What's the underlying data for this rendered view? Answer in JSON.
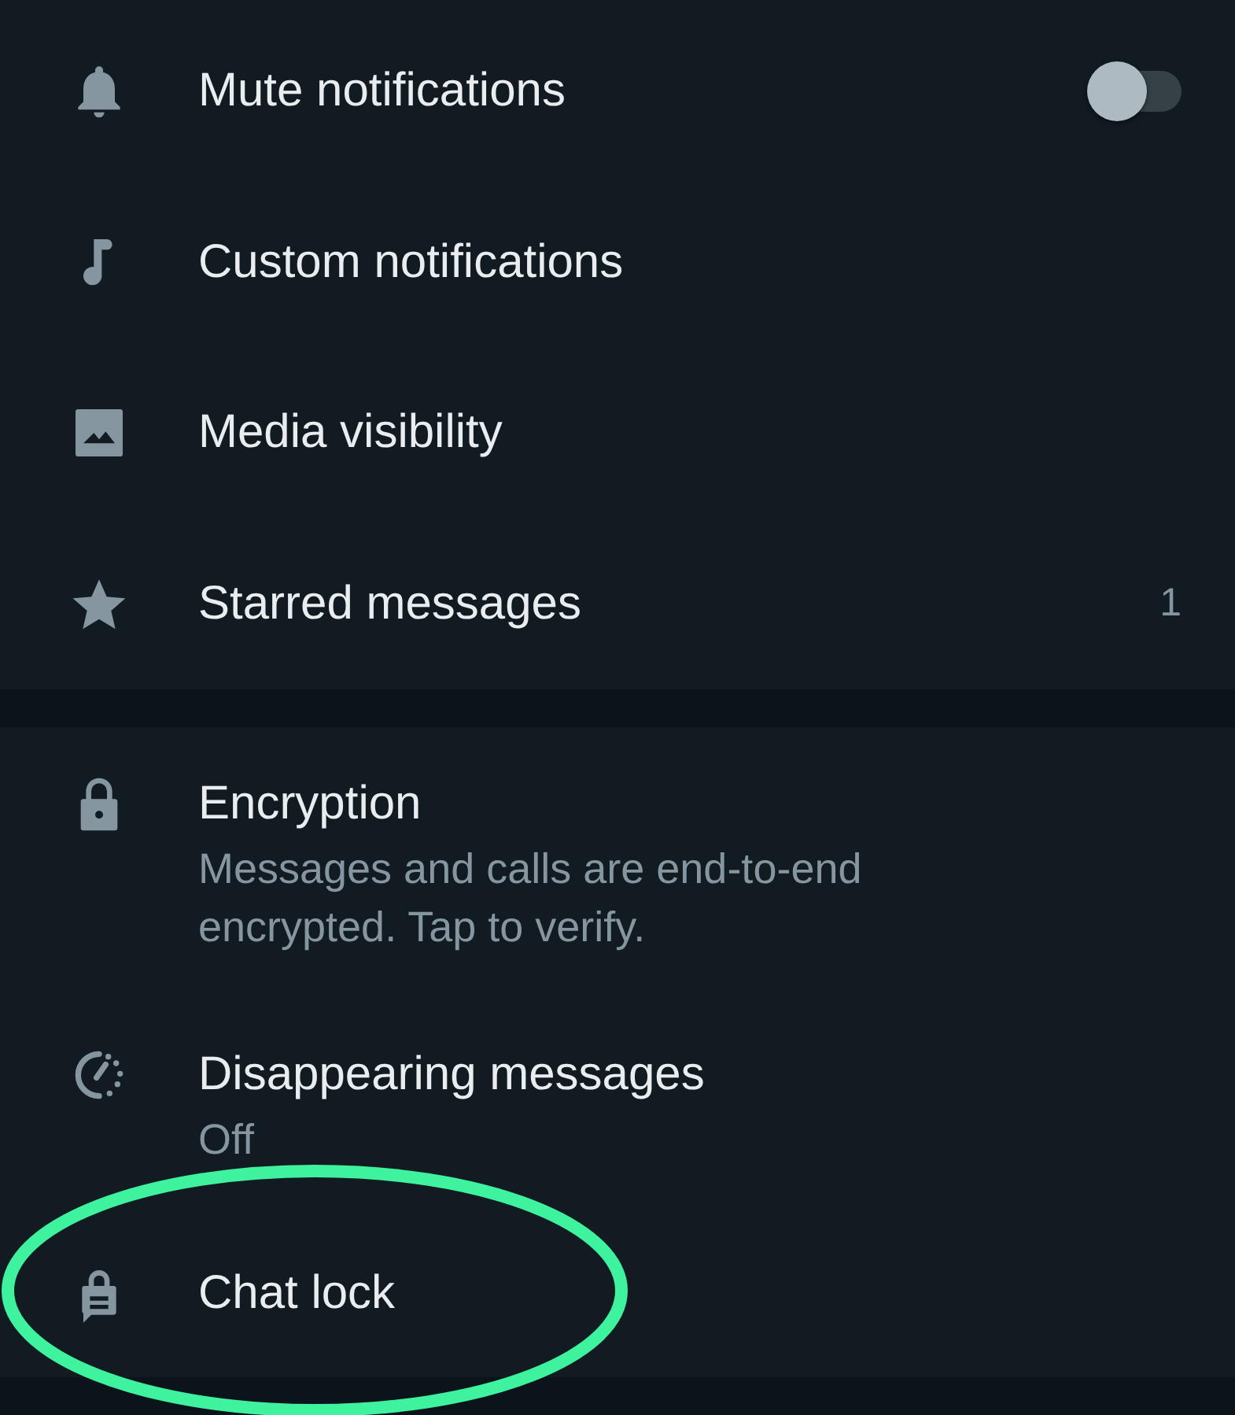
{
  "sections": [
    {
      "items": [
        {
          "kind": "toggle",
          "title": "Mute notifications",
          "on": false
        },
        {
          "kind": "plain",
          "title": "Custom notifications"
        },
        {
          "kind": "plain",
          "title": "Media visibility"
        },
        {
          "kind": "count",
          "title": "Starred messages",
          "count": "1"
        }
      ]
    },
    {
      "items": [
        {
          "kind": "plain",
          "title": "Encryption",
          "subtitle": "Messages and calls are end-to-end encrypted. Tap to verify."
        },
        {
          "kind": "plain",
          "title": "Disappearing messages",
          "subtitle": "Off"
        },
        {
          "kind": "plain",
          "title": "Chat lock"
        }
      ]
    }
  ],
  "annotation": {
    "kind": "ellipse"
  }
}
